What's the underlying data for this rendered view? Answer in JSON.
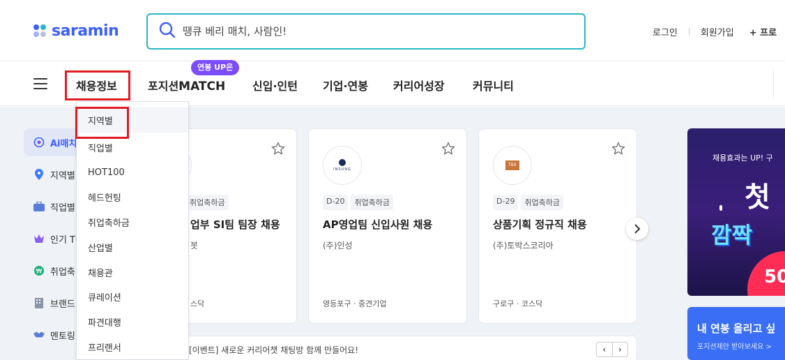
{
  "header": {
    "logo_text": "saramin",
    "search_placeholder": "땡큐 베리 매치, 사람인!",
    "links": {
      "login": "로그인",
      "signup": "회원가입",
      "profile": "+ 프로"
    }
  },
  "nav": {
    "items": [
      "채용정보",
      "포지션",
      "MATCH",
      "신입·인턴",
      "기업·연봉",
      "커리어성장",
      "커뮤니티"
    ],
    "badge": "연봉 UP은"
  },
  "dropdown": {
    "items": [
      "지역별",
      "직업별",
      "HOT100",
      "헤드헌팅",
      "취업축하금",
      "산업별",
      "채용관",
      "큐레이션",
      "파견대행",
      "프리랜서"
    ]
  },
  "sidebar": {
    "items": [
      "Ai매치",
      "지역별",
      "직업별",
      "인기 TO",
      "취업축",
      "브랜드",
      "멘토링"
    ]
  },
  "cards": [
    {
      "tag": "취업축하금",
      "title": "업부 SI팀 팀장 채용",
      "company": "봇",
      "location": "스닥"
    },
    {
      "dday": "D-20",
      "tag": "취업축하금",
      "title": "AP영업팀 신입사원 채용",
      "company": "(주)인성",
      "location": "영등포구 · 중견기업",
      "logo_text": "INSUNG"
    },
    {
      "dday": "D-29",
      "tag": "취업축하금",
      "title": "상품기획 정규직 채용",
      "company": "(주)토박스코리아",
      "location": "구로구 · 코스닥",
      "logo_text": "TBX"
    }
  ],
  "notice": {
    "text": "[이벤트] 새로운 커리어챗 채팅방 함께 만들어요!"
  },
  "ads": {
    "ad1": {
      "line1": "채용효과는 UP! 구",
      "big": "첫",
      "mid": "깜짝",
      "num": "50"
    },
    "ad2": {
      "title": "내 연봉 올리고 싶",
      "sub": "포지션제안 받아보세요 >"
    }
  },
  "colors": {
    "brand": "#3d5ffe",
    "search_border": "#28b6c4",
    "highlight_box": "#e21b23",
    "badge": "#7c4dff"
  }
}
